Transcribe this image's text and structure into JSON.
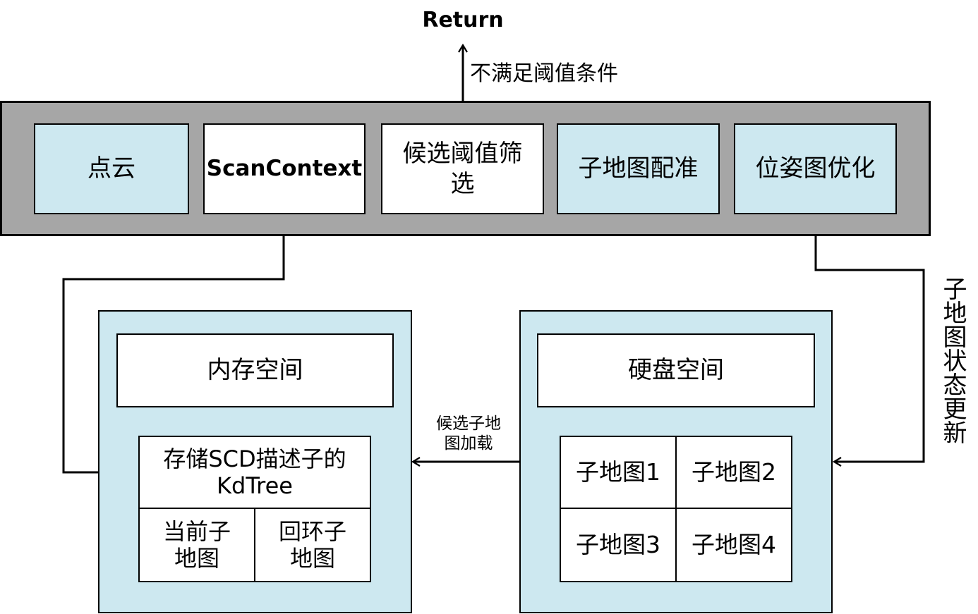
{
  "return_label": "Return",
  "threshold_fail_label": "不满足阈值条件",
  "pipeline": {
    "point_cloud": "点云",
    "scan_context": "ScanContext",
    "candidate_filter": "候选阈值筛选",
    "submap_registration": "子地图配准",
    "pose_graph_optimization": "位姿图优化"
  },
  "memory": {
    "title": "内存空间",
    "kdtree": "存储SCD描述子的KdTree",
    "current_submap": "当前子地图",
    "loop_submap": "回环子地图"
  },
  "disk": {
    "title": "硬盘空间",
    "submaps": [
      "子地图1",
      "子地图2",
      "子地图3",
      "子地图4"
    ]
  },
  "candidate_load_label": "候选子地图加载",
  "submap_state_update_label": "子地图状态更新",
  "colors": {
    "band": "#a6a6a6",
    "light_blue": "#cde8f0",
    "line": "#000000"
  }
}
